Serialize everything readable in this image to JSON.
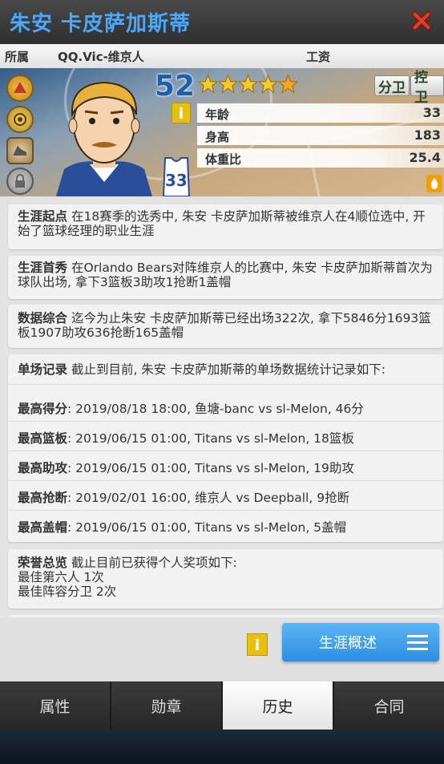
{
  "title": "朱安 卡皮萨加斯蒂",
  "header": {
    "team_label": "所属",
    "team_value": "QQ.Vic-维京人",
    "salary_label": "工资"
  },
  "player": {
    "rating": "52",
    "stars": 5,
    "jersey_number": "33",
    "positions": [
      "分卫",
      "控卫"
    ],
    "stats": [
      {
        "label": "年龄",
        "value": "33"
      },
      {
        "label": "身高",
        "value": "183"
      },
      {
        "label": "体重比",
        "value": "25.4"
      }
    ]
  },
  "cards": {
    "start": {
      "title": "生涯起点",
      "text": "在18赛季的选秀中, 朱安 卡皮萨加斯蒂被维京人在4顺位选中, 开始了篮球经理的职业生涯"
    },
    "debut": {
      "title": "生涯首秀",
      "text": "在Orlando Bears对阵维京人的比赛中, 朱安 卡皮萨加斯蒂首次为球队出场, 拿下3篮板3助攻1抢断1盖帽"
    },
    "summary": {
      "title": "数据综合",
      "text": "迄今为止朱安 卡皮萨加斯蒂已经出场322次, 拿下5846分1693篮板1907助攻636抢断165盖帽"
    },
    "records": {
      "title": "单场记录",
      "intro": "截止到目前, 朱安 卡皮萨加斯蒂的单场数据统计记录如下:",
      "rows": [
        {
          "label": "最高得分",
          "text": ": 2019/08/18 18:00, 鱼塘-banc vs sl-Melon, 46分"
        },
        {
          "label": "最高篮板",
          "text": ": 2019/06/15 01:00, Titans vs sl-Melon, 18篮板"
        },
        {
          "label": "最高助攻",
          "text": ": 2019/06/15 01:00, Titans vs sl-Melon, 19助攻"
        },
        {
          "label": "最高抢断",
          "text": ": 2019/02/01 16:00, 维京人 vs Deepball, 9抢断"
        },
        {
          "label": "最高盖帽",
          "text": ": 2019/06/15 01:00, Titans vs sl-Melon, 5盖帽"
        }
      ]
    },
    "honors": {
      "title": "荣誉总览",
      "intro": "截止目前已获得个人奖项如下:",
      "items": [
        "最佳第六人  1次",
        "最佳阵容分卫  2次"
      ]
    }
  },
  "career_button": "生涯概述",
  "tabs": [
    {
      "label": "属性",
      "active": false
    },
    {
      "label": "勋章",
      "active": false
    },
    {
      "label": "历史",
      "active": true
    },
    {
      "label": "合同",
      "active": false
    }
  ],
  "colors": {
    "title": "#4aa8ff",
    "accent": "#2d8de0",
    "badge": "#e8c015",
    "close": "#e03a2a"
  },
  "icons": [
    "close-icon",
    "info-icon",
    "menu-icon",
    "star-icon",
    "fire-icon",
    "skill-icon"
  ]
}
